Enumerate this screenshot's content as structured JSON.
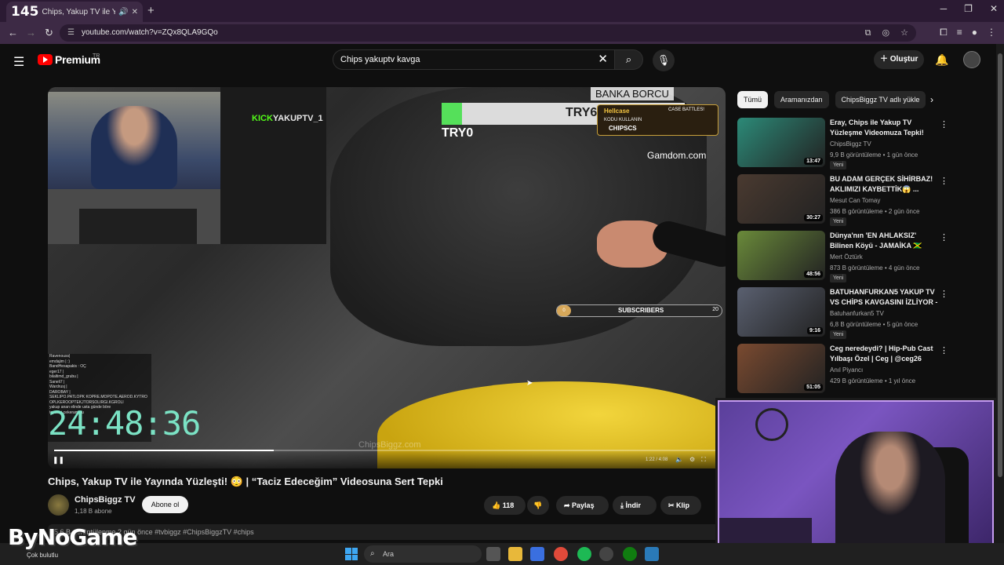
{
  "browser": {
    "tab_count": "145",
    "tab_title": "Chips, Yakup TV ile Yayında",
    "url": "youtube.com/watch?v=ZQx8QLA9GQo"
  },
  "youtube": {
    "logo_text": "Premium",
    "logo_country": "TR",
    "search_query": "Chips yakuptv kavga",
    "create_label": "Oluştur"
  },
  "video": {
    "overlay_banka": "BANKA BORCU",
    "overlay_try6": "TRY6",
    "overlay_try0": "TRY0",
    "kick_prefix": "KICK",
    "kick_channel": "YAKUPTV_1",
    "hellcase_label": "Hellcase",
    "hellcase_sub": "KODU KULLANIN",
    "hellcase_code": "CHIPSCS",
    "hellcase_battle": "CASE BATTLES!",
    "gamdom": "Gamdom.com",
    "subs_label": "SUBSCRIBERS",
    "subs_current": "0",
    "subs_goal": "20",
    "clock": "24:48:36",
    "watermark": "ChipsBiggz.com",
    "time": "1:22 / 4:08",
    "progress": 0.33,
    "chat_lines": [
      "Ravenouss| ",
      "emdajim | :)",
      "BandHesapakis : OÇ",
      "eger17 | ",
      "bilaltimd_grubu | ",
      "Saneli7 | ",
      "Wardrusj | ",
      "DAROBAY | ",
      "SEKLIPO.PATLOPK KOPRE.MOPOTE.AEROD.KYTRO",
      "ÖPLKEROOPTEKJTORSÖLIRGI.KGROLI",
      "yakup anan elinde usta günde böre",
      "tepeleri cekeram bu"
    ]
  },
  "watch": {
    "title": "Chips, Yakup TV ile Yayında Yüzleşti! 😳 | “Taciz Edeceğim” Videosuna Sert Tepki",
    "channel": "ChipsBiggz TV",
    "subscribers": "1,18 B abone",
    "subscribe_label": "Abone ol",
    "likes": "118",
    "share_label": "Paylaş",
    "download_label": "İndir",
    "clip_label": "Klip",
    "description": "5,6 B görüntülenme  2 gün önce  #tvbiggz #ChipsBiggzTV #chips"
  },
  "chips": [
    {
      "label": "Tümü",
      "active": true
    },
    {
      "label": "Aramanızdan",
      "active": false
    },
    {
      "label": "ChipsBiggz TV adlı yükle",
      "active": false
    }
  ],
  "recommendations": [
    {
      "title": "Eray, Chips ile Yakup TV Yüzleşme Videomuza Tepki!",
      "channel": "ChipsBiggz TV",
      "meta": "9,9 B görüntüleme • 1 gün önce",
      "duration": "13:47",
      "new_label": "Yeni",
      "thumb": "#2c8a78"
    },
    {
      "title": "BU ADAM GERÇEK SİHİRBAZ! AKLIMIZI KAYBETTİK😱 ...",
      "channel": "Mesut Can Tomay",
      "meta": "386 B görüntüleme • 2 gün önce",
      "duration": "30:27",
      "new_label": "Yeni",
      "thumb": "#4a3a30"
    },
    {
      "title": "Dünya'nın 'EN AHLAKSIZ' Bilinen Köyü - JAMAİKA 🇯🇲",
      "channel": "Mert Öztürk",
      "meta": "873 B görüntüleme • 4 gün önce",
      "duration": "48:56",
      "new_label": "Yeni",
      "thumb": "#6a8a3a"
    },
    {
      "title": "BATUHANFURKAN5 YAKUP TV VS CHİPS KAVGASINI İZLİYOR -",
      "channel": "Batuhanfurkan5 TV",
      "meta": "6,8 B görüntüleme • 5 gün önce",
      "duration": "9:16",
      "new_label": "Yeni",
      "thumb": "#5a6070"
    },
    {
      "title": "Ceg neredeydi? | Hip-Pub Cast Yılbaşı Özel | Ceg | @ceg26",
      "channel": "Anıl Piyancı",
      "meta": "429 B görüntüleme • 1 yıl önce",
      "duration": "51:05",
      "new_label": "",
      "thumb": "#7a4a30"
    }
  ],
  "overlay": {
    "brand": "ByNoGame",
    "weather": "Çok bulutlu"
  },
  "taskbar": {
    "search_label": "Ara"
  }
}
